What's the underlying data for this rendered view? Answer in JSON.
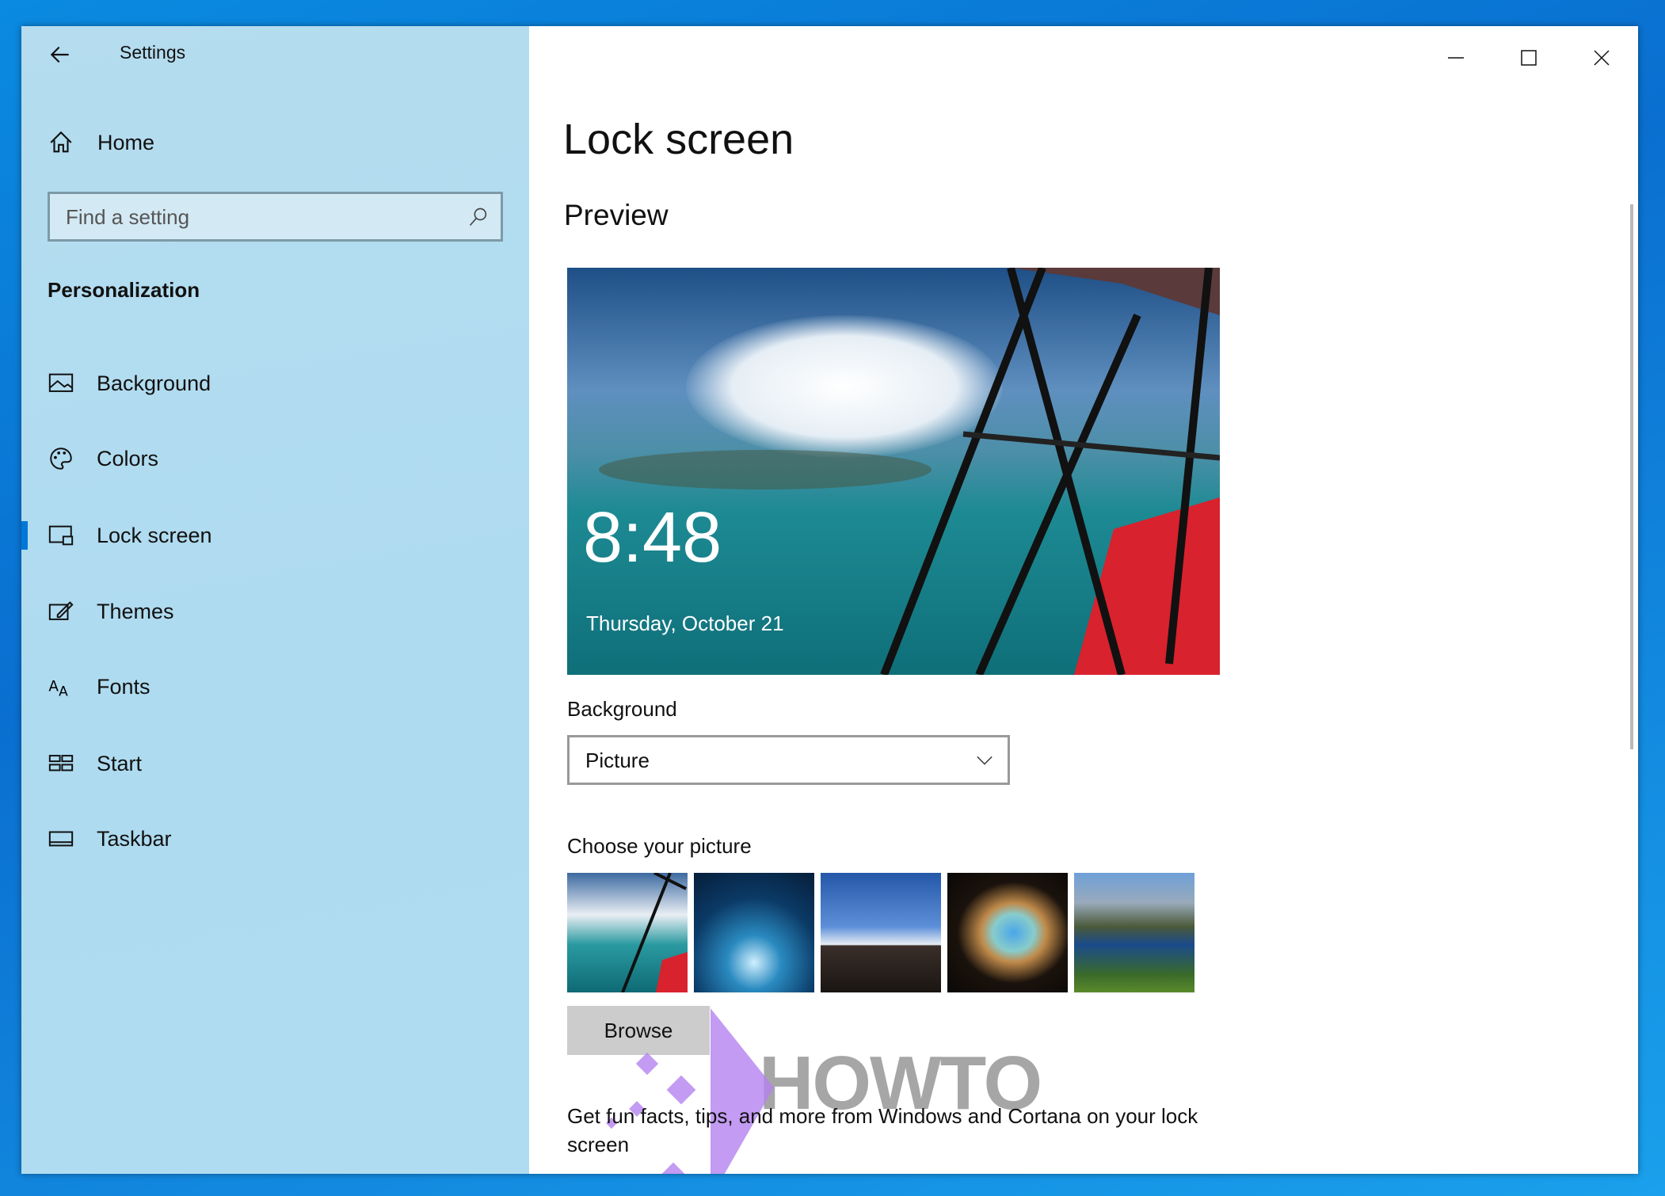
{
  "window": {
    "title": "Settings"
  },
  "sidebar": {
    "home": "Home",
    "search_placeholder": "Find a setting",
    "section": "Personalization",
    "items": [
      {
        "label": "Background",
        "icon": "picture-icon"
      },
      {
        "label": "Colors",
        "icon": "palette-icon"
      },
      {
        "label": "Lock screen",
        "icon": "lock-screen-icon",
        "active": true
      },
      {
        "label": "Themes",
        "icon": "themes-icon"
      },
      {
        "label": "Fonts",
        "icon": "fonts-icon"
      },
      {
        "label": "Start",
        "icon": "start-icon"
      },
      {
        "label": "Taskbar",
        "icon": "taskbar-icon"
      }
    ]
  },
  "main": {
    "title": "Lock screen",
    "preview_heading": "Preview",
    "preview_time": "8:48",
    "preview_date": "Thursday, October 21",
    "background_label": "Background",
    "background_value": "Picture",
    "choose_label": "Choose your picture",
    "browse": "Browse",
    "fun_facts": "Get fun facts, tips, and more from Windows and Cortana on your lock screen"
  },
  "watermark": "HOWTO",
  "colors": {
    "accent": "#0078d7",
    "sidebar": "#b0dcf1"
  }
}
